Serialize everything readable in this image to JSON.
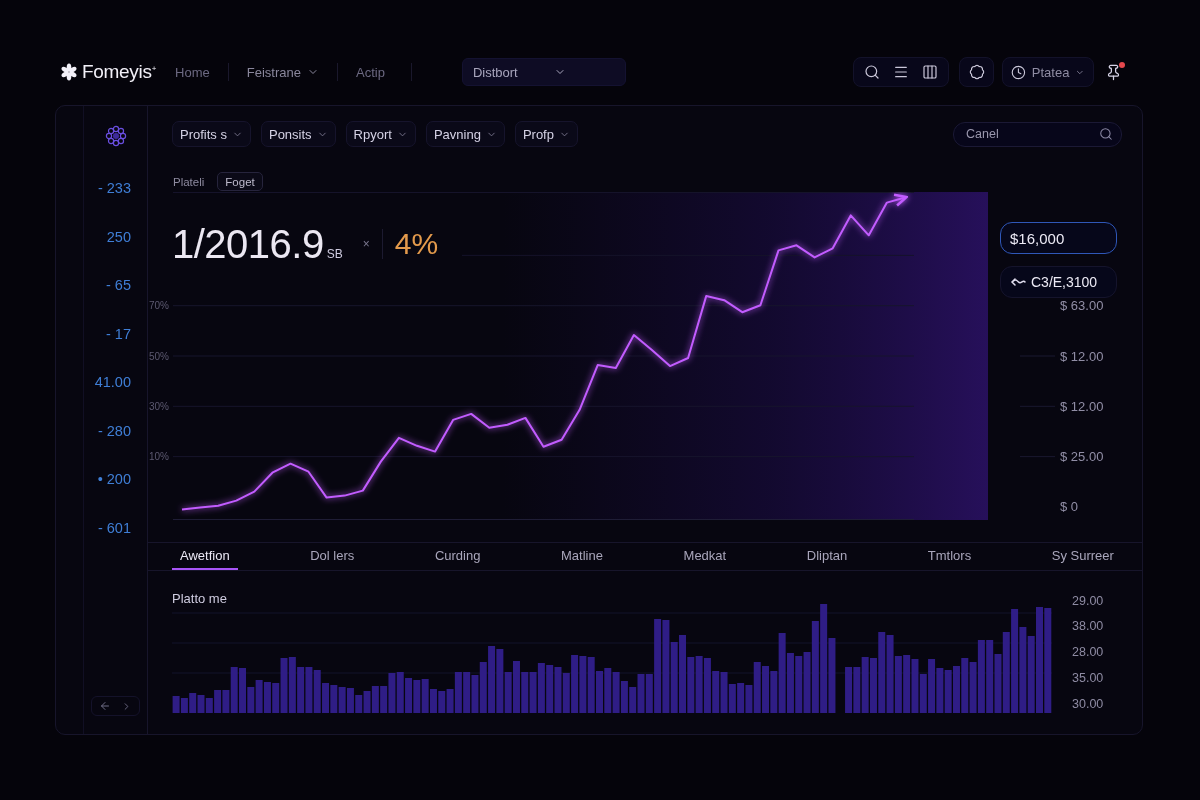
{
  "top_bar": {
    "logo": {
      "text": "Fomeyis$^{+}$"
    },
    "nav": [
      {
        "kind": "link",
        "label": "Home"
      },
      {
        "kind": "menu",
        "label": "Feistrane"
      },
      {
        "kind": "link",
        "label": "Actip"
      }
    ],
    "dropdown": {
      "value": "Distbort"
    },
    "profile_menu": {
      "label": "Ptatea"
    },
    "pin": {
      "unread": true
    }
  },
  "sidebar": {
    "values": [
      "- 233",
      "250",
      "- 65",
      "- 17",
      "41.00",
      "- 280",
      "• 200",
      "- 601"
    ]
  },
  "filters": [
    {
      "label": "Profits s"
    },
    {
      "label": "Ponsits"
    },
    {
      "label": "Rpyort"
    },
    {
      "label": "Pavning"
    },
    {
      "label": "Profp"
    }
  ],
  "search": {
    "placeholder": "Canel"
  },
  "overview": {
    "views": [
      {
        "label": "Plateli",
        "selected": false
      },
      {
        "label": "Foget",
        "selected": true
      }
    ],
    "headline": {
      "value": "1/2016.9",
      "unit": "SB",
      "dismiss": "×",
      "change": "4%"
    },
    "pills": [
      {
        "kind": "value",
        "text": "$16,000",
        "selected": true
      },
      {
        "kind": "trend",
        "text": "C3/E,3100",
        "selected": false
      }
    ],
    "line_chart": {
      "chart_data": {
        "type": "line",
        "grid": true,
        "categories": [
          null,
          null,
          null,
          null,
          null,
          null,
          null,
          null,
          null,
          null,
          null,
          null,
          null,
          null,
          null,
          null,
          null,
          null,
          null,
          null,
          null,
          null,
          null,
          null,
          null,
          null,
          null,
          null,
          null,
          null,
          null,
          null,
          null,
          null,
          null,
          null,
          null,
          null,
          null,
          null,
          null
        ],
        "series": [
          {
            "color": "#c25cff",
            "values": [
              -11.0,
              -10.2,
              -9.5,
              -7.5,
              -3.9,
              3.6,
              7.2,
              4.0,
              -6.3,
              -5.5,
              -3.5,
              8.0,
              17.5,
              14.3,
              12.0,
              24.6,
              27.0,
              21.5,
              22.7,
              25.4,
              13.9,
              16.7,
              28.6,
              46.4,
              45.2,
              58.3,
              52.4,
              46.0,
              49.2,
              73.8,
              72.2,
              67.4,
              70.2,
              92.0,
              94.0,
              89.2,
              92.8,
              105.9,
              98.0,
              111.0,
              113.0
            ]
          }
        ],
        "ylim": [
          -15,
          115
        ],
        "yticks": [
          {
            "value": 10,
            "label": "10%"
          },
          {
            "value": 30,
            "label": "30%"
          },
          {
            "value": 50,
            "label": "50%"
          },
          {
            "value": 70,
            "label": "70%"
          }
        ]
      },
      "right_axis_labels": [
        "$ 63.00",
        "$ 12.00",
        "$ 12.00",
        "$ 25.00",
        "$ 0"
      ]
    }
  },
  "tabs": [
    {
      "label": "Awetfion",
      "selected": true
    },
    {
      "label": "Dol lers",
      "selected": false
    },
    {
      "label": "Curding",
      "selected": false
    },
    {
      "label": "Matline",
      "selected": false
    },
    {
      "label": "Medkat",
      "selected": false
    },
    {
      "label": "Dliptan",
      "selected": false
    },
    {
      "label": "Tmtlors",
      "selected": false
    },
    {
      "label": "Sy Surreer",
      "selected": false
    }
  ],
  "bar_chart": {
    "title": "Platto me",
    "axis_labels": [
      "29.00",
      "38.00",
      "28.00",
      "35.00",
      "30.00"
    ]
  }
}
